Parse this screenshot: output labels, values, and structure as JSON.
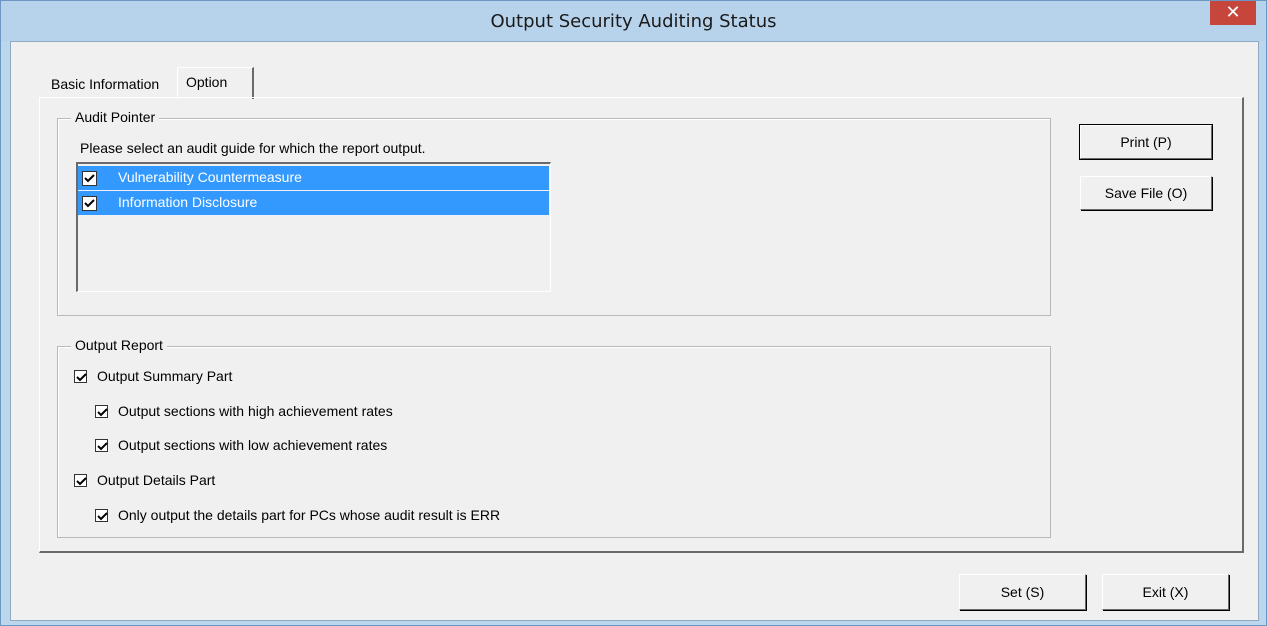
{
  "window": {
    "title": "Output Security Auditing Status",
    "close_glyph": "✕"
  },
  "tabs": [
    {
      "label": "Basic Information",
      "active": false
    },
    {
      "label": "Option",
      "active": true
    }
  ],
  "audit_pointer": {
    "legend": "Audit Pointer",
    "instruction": "Please select an audit guide for which the report output.",
    "items": [
      {
        "label": "Vulnerability Countermeasure",
        "checked": true,
        "selected": true
      },
      {
        "label": "Information Disclosure",
        "checked": true,
        "selected": true
      }
    ]
  },
  "output_report": {
    "legend": "Output Report",
    "options": [
      {
        "label": "Output Summary Part",
        "checked": true
      },
      {
        "label": "Output sections with high achievement rates",
        "checked": true
      },
      {
        "label": "Output sections with low achievement rates",
        "checked": true
      },
      {
        "label": "Output Details Part",
        "checked": true
      },
      {
        "label": "Only output the details part for PCs whose audit result is ERR",
        "checked": true
      }
    ]
  },
  "buttons": {
    "print": "Print (P)",
    "save_file": "Save File (O)",
    "set": "Set (S)",
    "exit": "Exit (X)"
  },
  "colors": {
    "selection": "#3399ff",
    "close": "#c7463c",
    "frame": "#bcd6ec"
  }
}
